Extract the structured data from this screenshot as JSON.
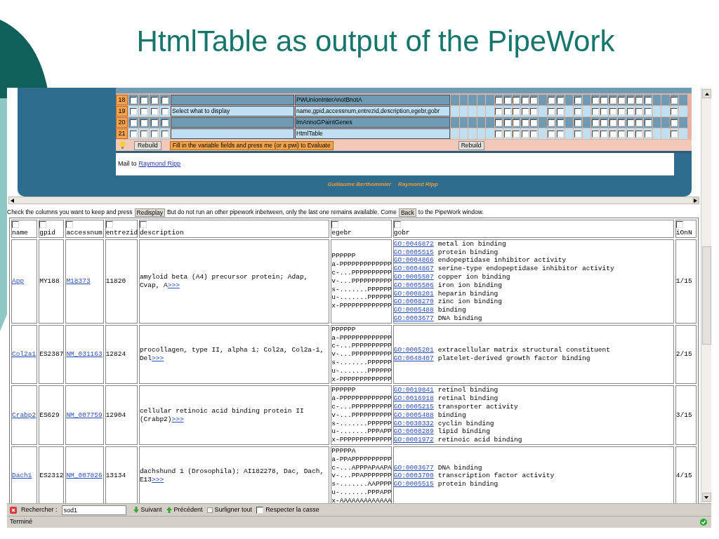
{
  "slide_title": "HtmlTable as output of the PipeWork",
  "pipework": {
    "rows": [
      {
        "number": "18",
        "checks": [
          false,
          false,
          false,
          false
        ],
        "value": "PWUnionInterAnotBnotA",
        "option_checks": [
          false,
          false,
          false,
          false,
          false,
          false,
          false,
          false,
          false,
          false,
          false,
          false,
          false,
          false,
          false,
          false
        ]
      },
      {
        "number": "19",
        "checks": [
          false,
          false,
          false,
          false
        ],
        "label": "Select what to display",
        "value": "name,gpid,accessnum,entrezid,description,egebr,gobr",
        "option_checks": [
          false,
          false,
          false,
          false,
          false,
          false,
          false,
          false,
          false,
          false,
          false,
          false,
          false,
          false,
          false,
          false
        ]
      },
      {
        "number": "20",
        "checks": [
          false,
          false,
          false,
          false
        ],
        "value": "lmAnnoGPaintGenes",
        "option_checks": [
          false,
          false,
          false,
          false,
          false,
          false,
          false,
          false,
          false,
          false,
          false,
          false,
          false,
          false,
          false,
          false
        ]
      },
      {
        "number": "21",
        "checks": [
          false,
          false,
          false,
          false
        ],
        "value": "HtmlTable",
        "option_checks": [
          false,
          false,
          false,
          false,
          false,
          false,
          false,
          false,
          false,
          false,
          false,
          false,
          false,
          false,
          false,
          false
        ]
      }
    ],
    "rebuild_button": "Rebuild",
    "evaluate_button": "Fill in the variable fields and press me (or a pwi) to Evaluate",
    "rebuild_button_2": "Rebuild",
    "mail_prefix": "Mail to",
    "mail_link": "Raymond Ripp",
    "credits": [
      "Guillaume Berthommier",
      "Raymond Ripp"
    ]
  },
  "instructions": {
    "before": "Check the columns you want to keep and press",
    "redisplay_button": "Redisplay",
    "middle": "But do not run an other pipework inbetween, only the last one remains available. Come",
    "back_button": "Back",
    "after": "to the PipeWork window."
  },
  "table": {
    "columns": [
      {
        "label": "name",
        "checked": false
      },
      {
        "label": "gpid",
        "checked": false
      },
      {
        "label": "accessnum",
        "checked": false
      },
      {
        "label": "entrezid",
        "checked": false
      },
      {
        "label": "description",
        "checked": false
      },
      {
        "label": "egebr",
        "checked": false
      },
      {
        "label": "gobr",
        "checked": false
      },
      {
        "label": "iOnN",
        "checked": false
      }
    ],
    "rows": [
      {
        "name": "App",
        "gpid": "MY188",
        "accessnum": "M18373",
        "entrezid": "11820",
        "description": "amyloid beta (A4) precursor protein; Adap, Cvap, A",
        "more": ">>>",
        "egebr": [
          "PPPPPP",
          "a-PPPPPPPPPPPPP",
          "c-...PPPPPPPPPP",
          "v-...PPPPPPPPPP",
          "s-.......PPPPPP",
          "u-.......PPPPPP",
          "x-PPPPPPPPPPPPP"
        ],
        "gobr": [
          {
            "id": "GO:0046872",
            "term": "metal ion binding"
          },
          {
            "id": "GO:0005515",
            "term": "protein binding"
          },
          {
            "id": "GO:0004866",
            "term": "endopeptidase inhibitor activity"
          },
          {
            "id": "GO:0004867",
            "term": "serine-type endopeptidase inhibitor activity"
          },
          {
            "id": "GO:0005507",
            "term": "copper ion binding"
          },
          {
            "id": "GO:0005506",
            "term": "iron ion binding"
          },
          {
            "id": "GO:0008201",
            "term": "heparin binding"
          },
          {
            "id": "GO:0008270",
            "term": "zinc ion binding"
          },
          {
            "id": "GO:0005488",
            "term": "binding"
          },
          {
            "id": "GO:0003677",
            "term": "DNA binding"
          }
        ],
        "ionn": "1/15"
      },
      {
        "name": "Col2a1",
        "gpid": "ES2387",
        "accessnum": "NM_031163",
        "entrezid": "12824",
        "description": "procollagen, type II, alpha 1; Col2a, Col2a-1, Del",
        "more": ">>>",
        "egebr": [
          "PPPPPP",
          "a-PPPPPPPPPPPPP",
          "c-...PPPPPPPPPP",
          "v-...PPPPPPPPPP",
          "s-.......PPPPPP",
          "u-.......PPPPPP",
          "x-PPPPPPPPPPPPP"
        ],
        "gobr": [
          {
            "id": "GO:0005201",
            "term": "extracellular matrix structural constituent"
          },
          {
            "id": "GO:0048407",
            "term": "platelet-derived growth factor binding"
          }
        ],
        "ionn": "2/15"
      },
      {
        "name": "Crabp2",
        "gpid": "ES629",
        "accessnum": "NM_007759",
        "entrezid": "12904",
        "description": "cellular retinoic acid binding protein II (Crabp2)",
        "more": ">>>",
        "egebr": [
          "PPPPPP",
          "a-PPPPPPPPPPPPP",
          "c-...PPPPPPPPPP",
          "v-...PPPPPPPPPP",
          "s-.......PPPPPP",
          "u-.......PPPAPP",
          "x-PPPPPPPPPPPPP"
        ],
        "gobr": [
          {
            "id": "GO:0019841",
            "term": "retinol binding"
          },
          {
            "id": "GO:0016918",
            "term": "retinal binding"
          },
          {
            "id": "GO:0005215",
            "term": "transporter activity"
          },
          {
            "id": "GO:0005488",
            "term": "binding"
          },
          {
            "id": "GO:0030332",
            "term": "cyclin binding"
          },
          {
            "id": "GO:0008289",
            "term": "lipid binding"
          },
          {
            "id": "GO:0001972",
            "term": "retinoic acid binding"
          }
        ],
        "ionn": "3/15"
      },
      {
        "name": "Dach1",
        "gpid": "ES2312",
        "accessnum": "NM_007826",
        "entrezid": "13134",
        "description": "dachshund 1 (Drosophila); AI182278, Dac, Dach, E13",
        "more": ">>>",
        "egebr": [
          "PPPPPA",
          "a-PPAPPPPPPPPPP",
          "c-...APPPAPAAPA",
          "v-...PPAPPPPPPP",
          "s-.......AAPPPP",
          "u-.......PPPAPP",
          "x-AAAAAAAAAAAAA"
        ],
        "gobr": [
          {
            "id": "GO:0003677",
            "term": "DNA binding"
          },
          {
            "id": "GO:0003700",
            "term": "transcription factor activity"
          },
          {
            "id": "GO:0005515",
            "term": "protein binding"
          }
        ],
        "ionn": "4/15"
      }
    ]
  },
  "find_bar": {
    "label": "Rechercher :",
    "value": "sod1",
    "next": "Suivant",
    "previous": "Précédent",
    "highlight": "Surligner tout",
    "match_case": {
      "label": "Respecter la casse",
      "checked": false
    }
  },
  "status_bar": {
    "text": "Terminé"
  }
}
